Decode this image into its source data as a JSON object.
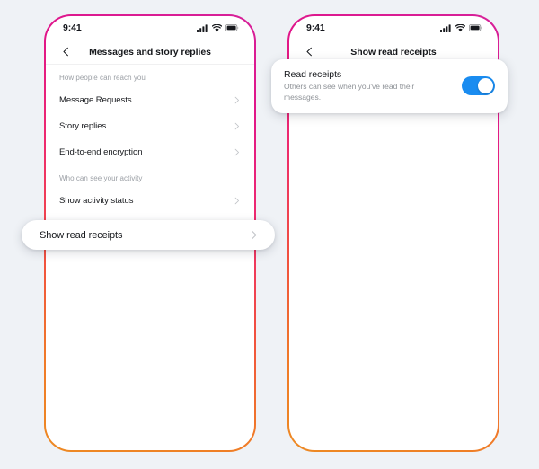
{
  "background_color": "#eff2f6",
  "accent": {
    "frame_gradient_start": "#d6219a",
    "frame_gradient_end": "#ed8a23",
    "toggle_on": "#1a8cf0"
  },
  "phones": [
    {
      "id": "left",
      "status_bar": {
        "time": "9:41",
        "icons": [
          "cellular-signal-icon",
          "wifi-icon",
          "battery-icon"
        ]
      },
      "nav": {
        "back_icon": "chevron-left-icon",
        "title": "Messages and story replies"
      },
      "sections": [
        {
          "label": "How people can reach you",
          "rows": [
            {
              "label": "Message Requests",
              "chevron": "chevron-right-icon"
            },
            {
              "label": "Story replies",
              "chevron": "chevron-right-icon"
            },
            {
              "label": "End-to-end encryption",
              "chevron": "chevron-right-icon"
            }
          ]
        },
        {
          "label": "Who can see your activity",
          "rows": [
            {
              "label": "Show activity status",
              "chevron": "chevron-right-icon"
            }
          ]
        }
      ],
      "highlight_pill": {
        "label": "Show read receipts",
        "chevron": "chevron-right-icon"
      }
    },
    {
      "id": "right",
      "status_bar": {
        "time": "9:41",
        "icons": [
          "cellular-signal-icon",
          "wifi-icon",
          "battery-icon"
        ]
      },
      "nav": {
        "back_icon": "chevron-left-icon",
        "title": "Show read receipts"
      },
      "highlight_card": {
        "title": "Read receipts",
        "subtitle": "Others can see when you've read their messages.",
        "toggle": {
          "state": "on",
          "color": "#1a8cf0"
        }
      }
    }
  ]
}
